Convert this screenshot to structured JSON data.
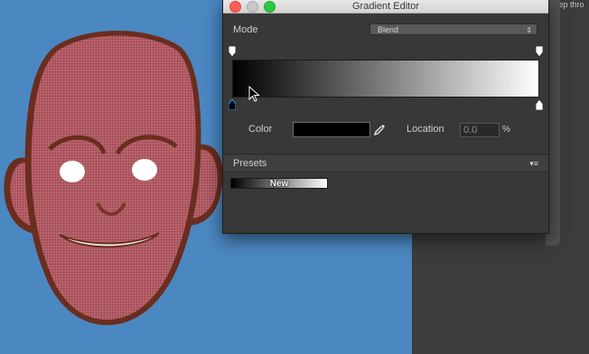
{
  "window": {
    "title": "Gradient Editor"
  },
  "background_text": "u step thro",
  "mode": {
    "label": "Mode",
    "value": "Blend"
  },
  "gradient": {
    "start_color": "#000000",
    "end_color": "#ffffff"
  },
  "color_field": {
    "label": "Color",
    "value": "#000000"
  },
  "location_field": {
    "label": "Location",
    "value": "0.0",
    "unit": "%"
  },
  "presets": {
    "label": "Presets",
    "items": [
      {
        "label": "New"
      }
    ]
  },
  "icons": {
    "eyedropper": "eyedropper-icon",
    "menu": "menu-icon",
    "dropdown": "chevron-updown-icon"
  }
}
